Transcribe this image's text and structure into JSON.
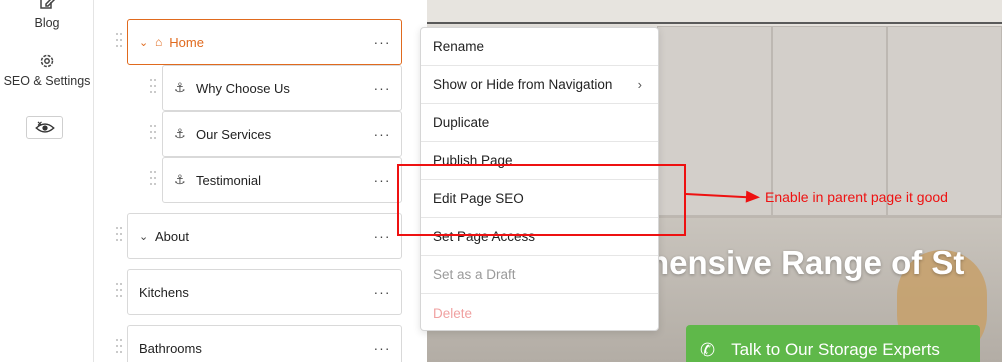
{
  "rail": {
    "blog_label": "Blog",
    "seo_label": "SEO & Settings"
  },
  "tree": {
    "pages": [
      {
        "label": "Home"
      },
      {
        "label": "Why Choose Us"
      },
      {
        "label": "Our Services"
      },
      {
        "label": "Testimonial"
      },
      {
        "label": "About"
      },
      {
        "label": "Kitchens"
      },
      {
        "label": "Bathrooms"
      }
    ],
    "more_glyph": "···"
  },
  "menu": {
    "items": [
      {
        "label": "Rename"
      },
      {
        "label": "Show or Hide from Navigation"
      },
      {
        "label": "Duplicate"
      },
      {
        "label": "Publish Page"
      },
      {
        "label": "Edit Page SEO"
      },
      {
        "label": "Set Page Access"
      },
      {
        "label": "Set as a Draft"
      },
      {
        "label": "Delete"
      }
    ]
  },
  "preview": {
    "hero_text": "hensive Range of St",
    "cta_label": "Talk to Our Storage Experts"
  },
  "annotation": {
    "note": "Enable in parent page it good"
  },
  "colors": {
    "accent": "#e06a1e",
    "annotation": "#ee1111",
    "cta": "#5fb84a"
  }
}
